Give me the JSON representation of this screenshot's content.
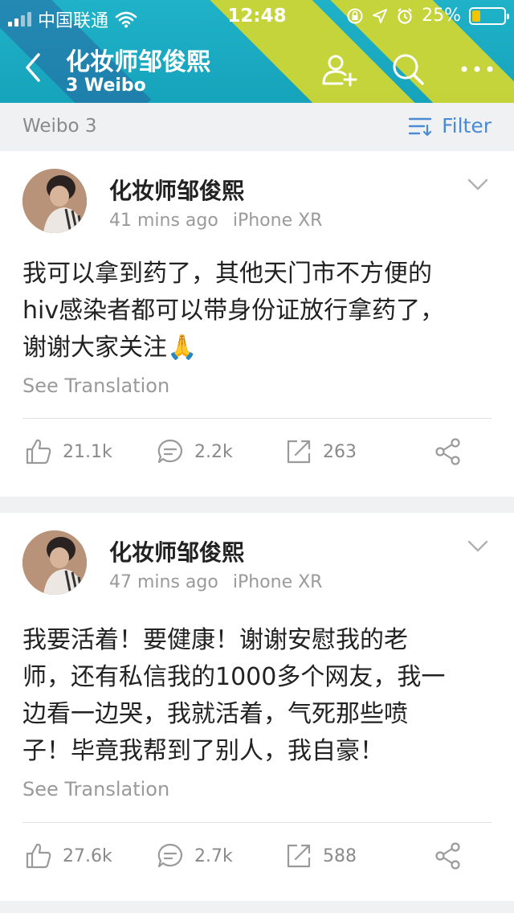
{
  "status_bar": {
    "carrier": "中国联通",
    "time": "12:48",
    "battery": "25%",
    "battery_level": 0.25
  },
  "nav": {
    "title": "化妆师邹俊熙",
    "subtitle": "3 Weibo"
  },
  "filter_bar": {
    "label": "Weibo 3",
    "filter_label": "Filter"
  },
  "posts": [
    {
      "author": "化妆师邹俊熙",
      "time": "41 mins ago",
      "source": "iPhone XR",
      "content_lines": [
        "我可以拿到药了，其他天门市不方便的",
        "hiv感染者都可以带身份证放行拿药了，",
        "谢谢大家关注🙏"
      ],
      "see_translation": "See Translation",
      "likes": "21.1k",
      "comments": "2.2k",
      "reposts": "263"
    },
    {
      "author": "化妆师邹俊熙",
      "time": "47 mins ago",
      "source": "iPhone XR",
      "content_lines": [
        "我要活着！要健康！谢谢安慰我的老",
        "师，还有私信我的1000多个网友，我一",
        "边看一边哭，我就活着，气死那些喷",
        "子！毕竟我帮到了别人，我自豪！"
      ],
      "see_translation": "See Translation",
      "likes": "27.6k",
      "comments": "2.7k",
      "reposts": "588"
    }
  ],
  "icons": [
    "signal-icon",
    "wifi-icon",
    "lock-rotation-icon",
    "location-icon",
    "alarm-icon",
    "battery-icon",
    "back-icon",
    "add-user-icon",
    "search-icon",
    "more-icon",
    "filter-icon",
    "chevron-down-icon",
    "like-icon",
    "comment-icon",
    "repost-icon",
    "share-icon"
  ],
  "colors": {
    "header": "#1fb2c8",
    "stripe": "#cfd633",
    "link": "#4a8bd4",
    "battery_fill": "#f5c400"
  }
}
